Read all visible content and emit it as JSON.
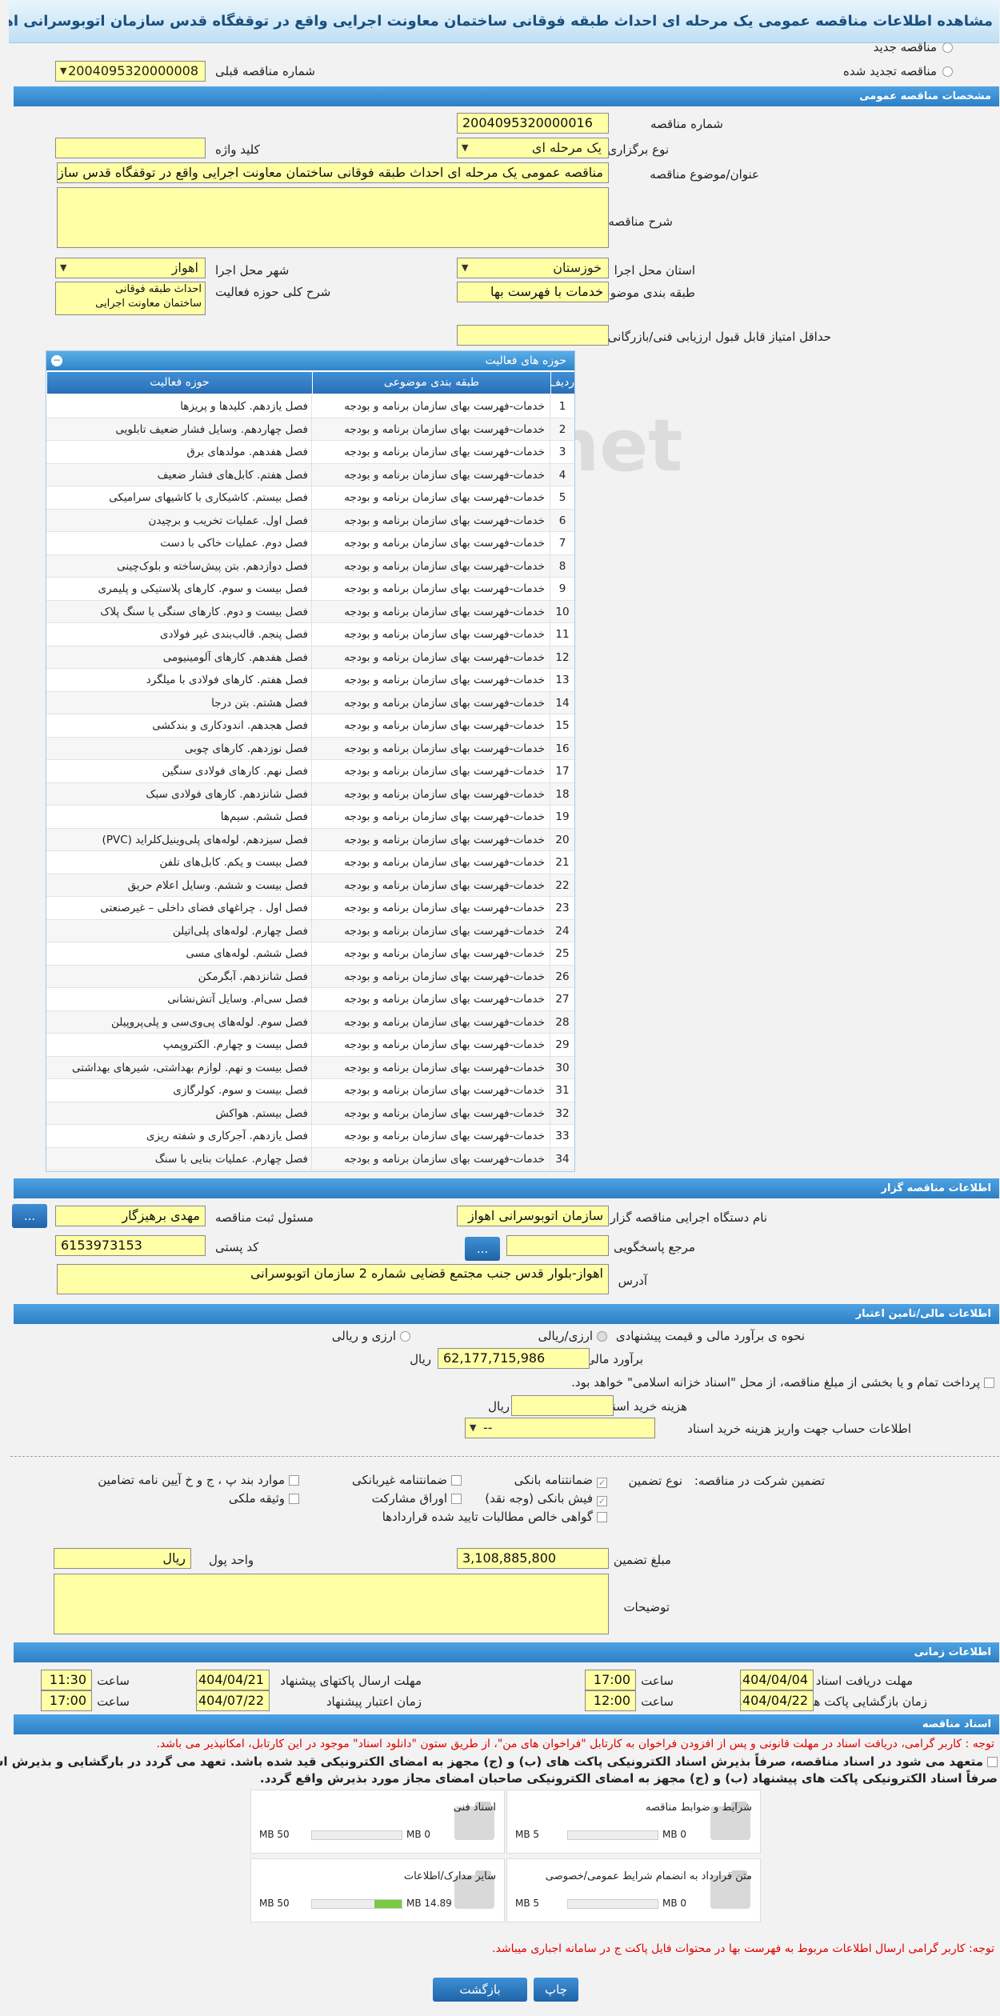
{
  "title": "مشاهده اطلاعات مناقصه عمومی یک مرحله ای احداث طبقه فوقانی ساختمان معاونت اجرایی واقع در توقفگاه قدس سازمان اتوبوسرانی اهواز",
  "top": {
    "new_tender": "مناقصه جدید",
    "renewed_tender": "مناقصه تجدید شده",
    "prev_tender_label": "شماره مناقصه قبلی",
    "prev_tender_value": "2004095320000008"
  },
  "sections": {
    "general": "مشخصات مناقصه عمومی",
    "activity": "حوزه های فعالیت",
    "organizer": "اطلاعات مناقصه گزار",
    "finance": "اطلاعات مالی/تامین اعتبار",
    "timing": "اطلاعات زمانی",
    "docs": "اسناد مناقصه"
  },
  "general": {
    "tender_no_label": "شماره مناقصه",
    "tender_no": "2004095320000016",
    "type_label": "نوع برگزاری",
    "type": "یک مرحله ای",
    "keyword_label": "کلید واژه",
    "subject_label": "عنوان/موضوع مناقصه",
    "subject": "مناقصه عمومی یک مرحله ای احداث طبقه فوقانی ساختمان معاونت اجرایی واقع در توقفگاه قدس سازمان",
    "desc_label": "شرح مناقصه",
    "province_label": "استان محل اجرا",
    "province": "خوزستان",
    "city_label": "شهر محل اجرا",
    "city": "اهواز",
    "category_label": "طبقه بندی موضوعی",
    "category": "خدمات با فهرست بها",
    "scope_label": "شرح کلی حوزه فعالیت",
    "scope_line1": "احداث طبقه فوقانی",
    "scope_line2": "ساختمان معاونت اجرایی",
    "min_score_label": "حداقل امتیاز قابل قبول ارزیابی فنی/بازرگانی"
  },
  "grid": {
    "col_row": "ردیف",
    "col_cat": "طبقه بندی موضوعی",
    "col_act": "حوزه فعالیت",
    "rows": [
      {
        "n": "1",
        "cat": "خدمات-فهرست بهای سازمان برنامه و بودجه",
        "act": "فصل یازدهم. کلیدها و پریزها"
      },
      {
        "n": "2",
        "cat": "خدمات-فهرست بهای سازمان برنامه و بودجه",
        "act": "فصل چهاردهم. وسایل فشار ضعیف تابلویی"
      },
      {
        "n": "3",
        "cat": "خدمات-فهرست بهای سازمان برنامه و بودجه",
        "act": "فصل هفدهم. مولدهای برق"
      },
      {
        "n": "4",
        "cat": "خدمات-فهرست بهای سازمان برنامه و بودجه",
        "act": "فصل هفتم. کابل‌های فشار ضعیف"
      },
      {
        "n": "5",
        "cat": "خدمات-فهرست بهای سازمان برنامه و بودجه",
        "act": "فصل بیستم. کاشیکاری با کاشیهای سرامیکی"
      },
      {
        "n": "6",
        "cat": "خدمات-فهرست بهای سازمان برنامه و بودجه",
        "act": "فصل اول. عملیات تخریب و برچیدن"
      },
      {
        "n": "7",
        "cat": "خدمات-فهرست بهای سازمان برنامه و بودجه",
        "act": "فصل دوم. عملیات خاکی با دست"
      },
      {
        "n": "8",
        "cat": "خدمات-فهرست بهای سازمان برنامه و بودجه",
        "act": "فصل دوازدهم. بتن پیش‌ساخته و بلوک‌چینی"
      },
      {
        "n": "9",
        "cat": "خدمات-فهرست بهای سازمان برنامه و بودجه",
        "act": "فصل بیست و سوم. کارهای پلاستیکی و پلیمری"
      },
      {
        "n": "10",
        "cat": "خدمات-فهرست بهای سازمان برنامه و بودجه",
        "act": "فصل بیست و دوم. کارهای سنگی با سنگ پلاک"
      },
      {
        "n": "11",
        "cat": "خدمات-فهرست بهای سازمان برنامه و بودجه",
        "act": "فصل پنجم. قالب‌بندی غیر فولادی"
      },
      {
        "n": "12",
        "cat": "خدمات-فهرست بهای سازمان برنامه و بودجه",
        "act": "فصل هفدهم. کارهای آلومینیومی"
      },
      {
        "n": "13",
        "cat": "خدمات-فهرست بهای سازمان برنامه و بودجه",
        "act": "فصل هفتم. کارهای فولادی با میلگرد"
      },
      {
        "n": "14",
        "cat": "خدمات-فهرست بهای سازمان برنامه و بودجه",
        "act": "فصل هشتم. بتن درجا"
      },
      {
        "n": "15",
        "cat": "خدمات-فهرست بهای سازمان برنامه و بودجه",
        "act": "فصل هجدهم. اندودکاری و بندکشی"
      },
      {
        "n": "16",
        "cat": "خدمات-فهرست بهای سازمان برنامه و بودجه",
        "act": "فصل نوزدهم. کارهای چوبی"
      },
      {
        "n": "17",
        "cat": "خدمات-فهرست بهای سازمان برنامه و بودجه",
        "act": "فصل نهم. کارهای فولادی سنگین"
      },
      {
        "n": "18",
        "cat": "خدمات-فهرست بهای سازمان برنامه و بودجه",
        "act": "فصل شانزدهم. کارهای فولادی سبک"
      },
      {
        "n": "19",
        "cat": "خدمات-فهرست بهای سازمان برنامه و بودجه",
        "act": "فصل ششم. سیم‌ها"
      },
      {
        "n": "20",
        "cat": "خدمات-فهرست بهای سازمان برنامه و بودجه",
        "act": "فصل سیزدهم. لوله‌های پلی‌وینیل‌کلراید (PVC)"
      },
      {
        "n": "21",
        "cat": "خدمات-فهرست بهای سازمان برنامه و بودجه",
        "act": "فصل بیست و یکم. کابل‌های تلفن"
      },
      {
        "n": "22",
        "cat": "خدمات-فهرست بهای سازمان برنامه و بودجه",
        "act": "فصل بیست و ششم. وسایل اعلام حریق"
      },
      {
        "n": "23",
        "cat": "خدمات-فهرست بهای سازمان برنامه و بودجه",
        "act": "فصل اول . چراغهای فضای داخلی – غیرصنعتی"
      },
      {
        "n": "24",
        "cat": "خدمات-فهرست بهای سازمان برنامه و بودجه",
        "act": "فصل چهارم. لوله‌های پلی‌اتیلن"
      },
      {
        "n": "25",
        "cat": "خدمات-فهرست بهای سازمان برنامه و بودجه",
        "act": "فصل ششم. لوله‌های مسی"
      },
      {
        "n": "26",
        "cat": "خدمات-فهرست بهای سازمان برنامه و بودجه",
        "act": "فصل شانزدهم. آبگرمکن"
      },
      {
        "n": "27",
        "cat": "خدمات-فهرست بهای سازمان برنامه و بودجه",
        "act": "فصل سی‌ام. وسایل آتش‌نشانی"
      },
      {
        "n": "28",
        "cat": "خدمات-فهرست بهای سازمان برنامه و بودجه",
        "act": "فصل سوم. لوله‌های پی‌وی‌سی و پلی‌پروپیلن"
      },
      {
        "n": "29",
        "cat": "خدمات-فهرست بهای سازمان برنامه و بودجه",
        "act": "فصل بیست و چهارم. الکتروپمپ"
      },
      {
        "n": "30",
        "cat": "خدمات-فهرست بهای سازمان برنامه و بودجه",
        "act": "فصل بیست و نهم. لوازم بهداشتی، شیرهای بهداشتی"
      },
      {
        "n": "31",
        "cat": "خدمات-فهرست بهای سازمان برنامه و بودجه",
        "act": "فصل بیست و سوم. کولرگازی"
      },
      {
        "n": "32",
        "cat": "خدمات-فهرست بهای سازمان برنامه و بودجه",
        "act": "فصل بیستم. هواکش"
      },
      {
        "n": "33",
        "cat": "خدمات-فهرست بهای سازمان برنامه و بودجه",
        "act": "فصل یازدهم. آجرکاری و شفته ریزی"
      },
      {
        "n": "34",
        "cat": "خدمات-فهرست بهای سازمان برنامه و بودجه",
        "act": "فصل چهارم. عملیات بنایی با سنگ"
      }
    ]
  },
  "organizer": {
    "exec_label": "نام دستگاه اجرایی مناقصه گزار",
    "exec": "سازمان اتوبوسرانی اهواز",
    "reg_label": "مسئول ثبت مناقصه",
    "reg": "مهدی برهیزگار",
    "ref_label": "مرجع پاسخگویی",
    "postal_label": "کد پستی",
    "postal": "6153973153",
    "addr_label": "آدرس",
    "addr": "اهواز-بلوار قدس جنب مجتمع قضایی شماره 2 سازمان اتوبوسرانی",
    "more": "..."
  },
  "finance": {
    "method_label": "نحوه ی برآورد مالی و قیمت پیشنهادی",
    "opt1": "ارزی/ریالی",
    "opt2": "ارزی و ریالی",
    "estimate_label": "برآورد مالی",
    "estimate": "62,177,715,986",
    "rial": "ریال",
    "payment_note": "پرداخت تمام و یا بخشی از مبلغ مناقصه، از محل \"اسناد خزانه اسلامی\" خواهد بود.",
    "doc_cost_label": "هزینه خرید اسناد",
    "doc_cost_unit": "ریال",
    "account_label": "اطلاعات حساب جهت واریز هزینه خرید اسناد",
    "account": "--"
  },
  "guarantee": {
    "label": "تضمین شرکت در مناقصه:",
    "type_label": "نوع تضمین",
    "g1": "ضمانتنامه بانکی",
    "g2": "ضمانتنامه غیربانکی",
    "g3": "موارد بند پ ، ج و خ آیین نامه تضامین",
    "g4": "فیش بانکی (وجه نقد)",
    "g5": "اوراق مشارکت",
    "g6": "وثیقه ملکی",
    "g7": "گواهی خالص مطالبات تایید شده قراردادها",
    "amount_label": "مبلغ تضمین",
    "amount": "3,108,885,800",
    "currency_label": "واحد پول",
    "currency": "ریال",
    "notes_label": "توضیحات"
  },
  "timing": {
    "doc_receive_label": "مهلت دریافت اسناد",
    "doc_receive_date": "1404/04/04",
    "doc_receive_time": "17:00",
    "send_label": "مهلت ارسال پاکتهای پیشنهاد",
    "send_date": "1404/04/21",
    "send_time": "11:30",
    "open_label": "زمان بازگشایی پاکت ها",
    "open_date": "1404/04/22",
    "open_time": "12:00",
    "valid_label": "زمان اعتبار پیشنهاد",
    "valid_date": "1404/07/22",
    "valid_time": "17:00",
    "time_label": "ساعت"
  },
  "docs": {
    "note1": "توجه : کاربر گرامی، دریافت اسناد در مهلت قانونی و پس از افزودن فراخوان به کارتابل \"فراخوان های من\"، از طریق ستون \"دانلود اسناد\" موجود در این کارتابل، امکانپذیر می باشد.",
    "pledge1": "متعهد می شود در اسناد مناقصه، صرفاً بذیرش اسناد الکترونیکی پاکت های (ب) و (ج) مجهز به امضای الکترونیکی قید شده باشد. تعهد می گردد در بارگشایی و بذیرش اسناد،",
    "pledge2": "صرفاً اسناد الکترونیکی پاکت های پیشنهاد (ب) و (ج) مجهز به امضای الکترونیکی صاحبان امضای مجاز مورد بذیرش واقع گردد.",
    "files": [
      {
        "name": "شرایط و ضوابط مناقصه",
        "min": "0 MB",
        "max": "5 MB",
        "fill": 0
      },
      {
        "name": "اسناد فنی",
        "min": "0 MB",
        "max": "50 MB",
        "fill": 0
      },
      {
        "name": "متن قرارداد به انضمام شرایط عمومی/خصوصی",
        "min": "0 MB",
        "max": "5 MB",
        "fill": 0
      },
      {
        "name": "سایر مدارک/اطلاعات",
        "min": "14.89 MB",
        "max": "50 MB",
        "fill": 0.3
      }
    ],
    "note2": "توجه: کاربر گرامی ارسال اطلاعات مربوط به فهرست بها در محتوات فایل پاکت ج در سامانه اجباری میباشد."
  },
  "buttons": {
    "print": "چاپ",
    "back": "بازگشت"
  },
  "watermark": "iriatender.net"
}
